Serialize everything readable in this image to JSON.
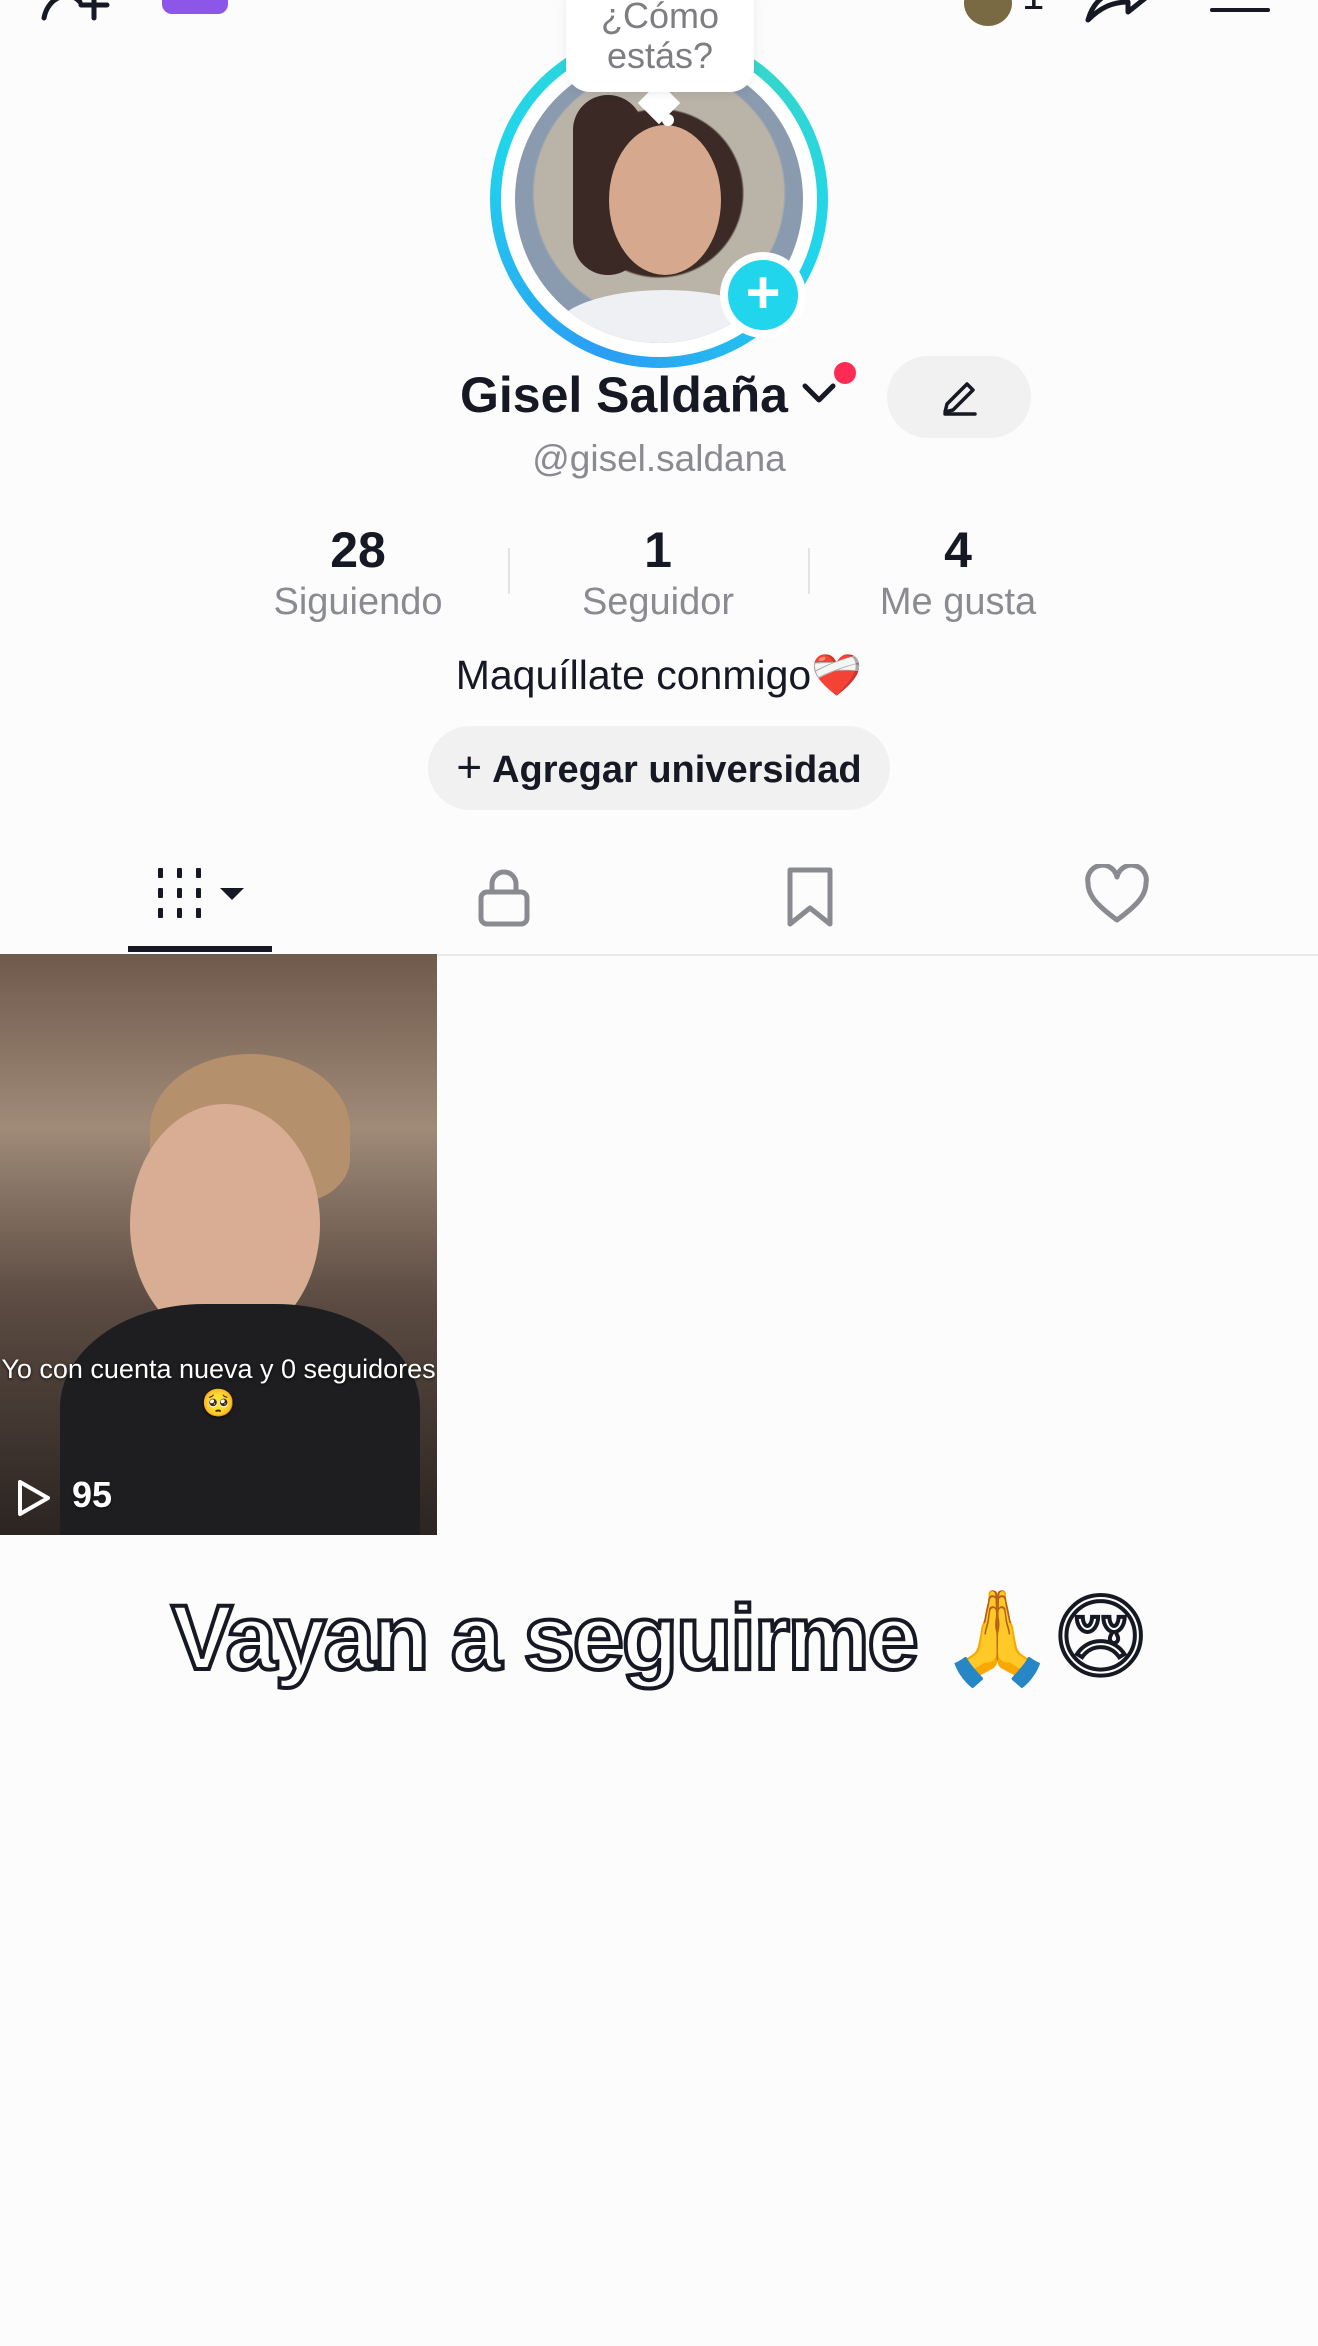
{
  "header": {
    "notification_count": "",
    "switch_count": "1"
  },
  "profile": {
    "bubble_text": "¿Cómo estás?",
    "display_name": "Gisel Saldaña",
    "username": "@gisel.saldana",
    "bio": "Maquíllate conmigo❤️‍🩹",
    "add_university_label": "Agregar universidad"
  },
  "stats": [
    {
      "value": "28",
      "label": "Siguiendo"
    },
    {
      "value": "1",
      "label": "Seguidor"
    },
    {
      "value": "4",
      "label": "Me gusta"
    }
  ],
  "tabs": [
    {
      "icon": "grid-videos-icon",
      "active": true
    },
    {
      "icon": "lock-icon",
      "active": false
    },
    {
      "icon": "bookmark-icon",
      "active": false
    },
    {
      "icon": "heart-icon",
      "active": false
    }
  ],
  "videos": [
    {
      "caption": "Yo con cuenta nueva y 0 seguidores 🥺",
      "plays": "95"
    }
  ],
  "overlay_caption": "Vayan a seguirme 🙏😢",
  "colors": {
    "accent_cyan": "#20d5ec",
    "notification_red": "#fe2c55",
    "purple_pill": "#8c57e8"
  }
}
